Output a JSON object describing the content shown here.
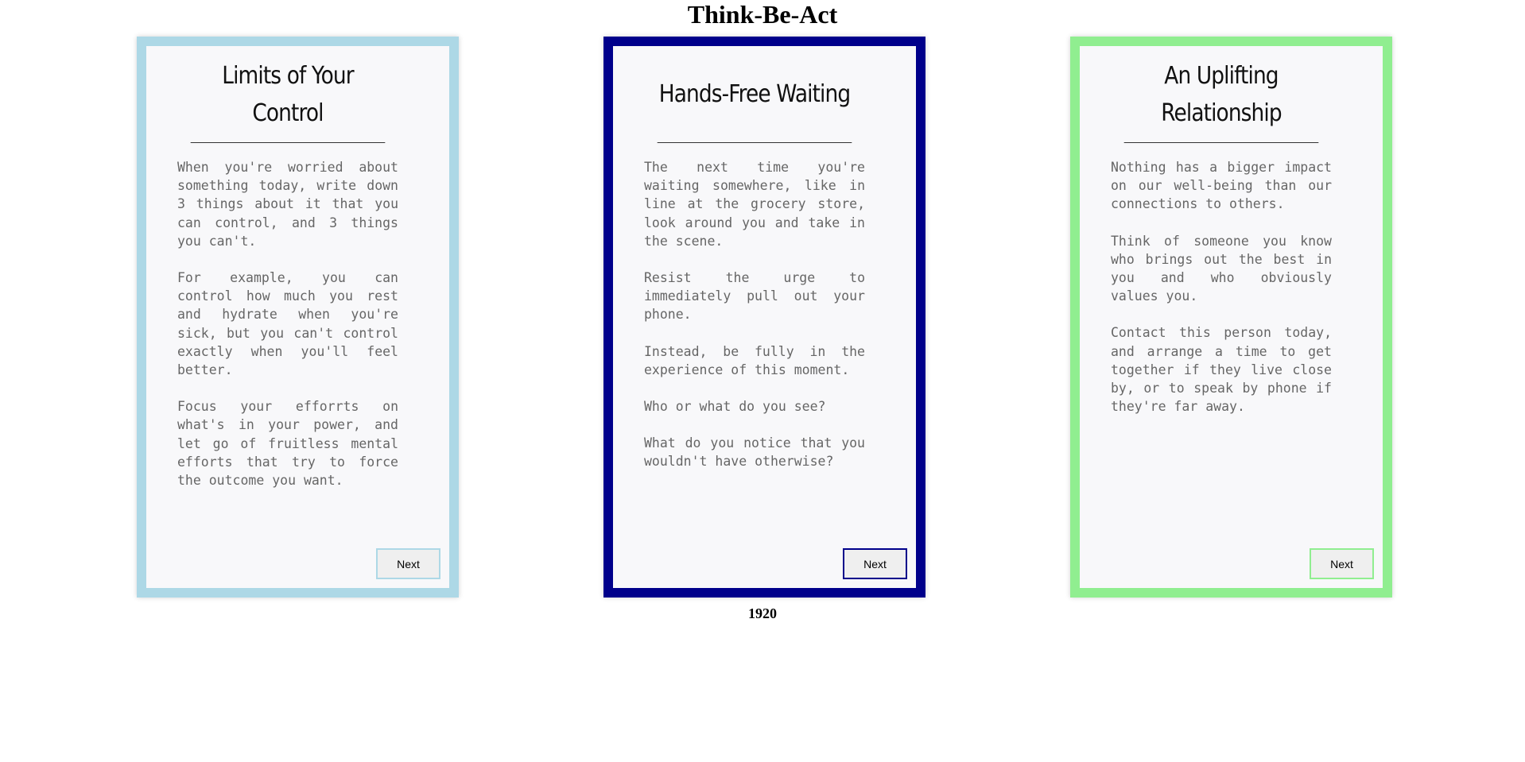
{
  "page": {
    "title": "Think-Be-Act",
    "footer_year": "1920"
  },
  "cards": [
    {
      "title": "Limits of Your Control",
      "border_color": "#add8e6",
      "paragraphs": [
        "When you're worried about something today, write down 3 things about it that you can control, and 3 things you can't.",
        "For example, you can control how much you rest and hydrate when you're sick, but you can't control exactly when you'll feel better.",
        "Focus your efforrts on what's in your power, and let go of fruitless mental efforts that try to force the outcome you want."
      ],
      "button_label": "Next"
    },
    {
      "title": "Hands-Free Waiting",
      "border_color": "#00008b",
      "paragraphs": [
        "The next time you're waiting somewhere, like in line at the grocery store, look around you and take in the scene.",
        "Resist the urge to immediately pull out your phone.",
        "Instead, be fully in the experience of this moment.",
        "Who or what do you see?",
        "What do you notice that you wouldn't have otherwise?"
      ],
      "button_label": "Next"
    },
    {
      "title": "An Uplifting Relationship",
      "border_color": "#90ee90",
      "paragraphs": [
        "Nothing has a bigger impact on our well-being than our connections to others.",
        "Think of someone you know who brings out the best in you and who obviously values you.",
        "Contact this person today, and arrange a time to get together if they live close by, or to speak by phone if they're far away."
      ],
      "button_label": "Next"
    }
  ]
}
